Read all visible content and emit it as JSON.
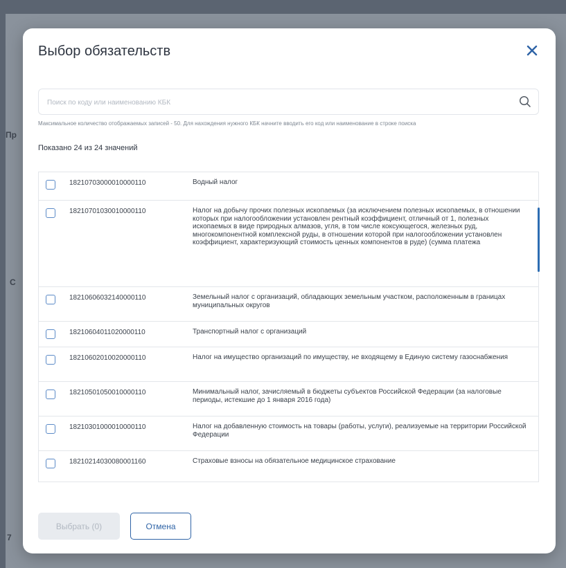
{
  "background": {
    "hints": [
      "Пр",
      "С",
      "7"
    ]
  },
  "modal": {
    "title": "Выбор обязательств",
    "close_icon": "close-icon",
    "search": {
      "placeholder": "Поиск по коду или наименованию КБК",
      "value": "",
      "icon": "search-icon"
    },
    "hint": "Максимальное количество отображаемых записей - 50. Для нахождения нужного КБК начните вводить его код или наименование в строке поиска",
    "shown_text": "Показано 24 из 24 значений",
    "rows": [
      {
        "code": "18210703000010000110",
        "name": "Водный налог"
      },
      {
        "code": "18210701030010000110",
        "name": "Налог на добычу прочих полезных ископаемых (за исключением полезных ископаемых, в отношении которых при налогообложении установлен рентный коэффициент, отличный от 1, полезных ископаемых в виде природных алмазов, угля, в том числе коксующегося, железных руд, многокомпонентной комплексной руды, в отношении которой при налогообложении установлен коэффициент, характеризующий стоимость ценных компонентов в руде) (сумма платежа"
      },
      {
        "code": "18210606032140000110",
        "name": "Земельный налог с организаций, обладающих земельным участком, расположенным в границах муниципальных округов"
      },
      {
        "code": "18210604011020000110",
        "name": "Транспортный налог с организаций"
      },
      {
        "code": "18210602010020000110",
        "name": "Налог на имущество организаций по имуществу, не входящему в Единую систему газоснабжения"
      },
      {
        "code": "18210501050010000110",
        "name": "Минимальный налог, зачисляемый в бюджеты субъектов Российской Федерации (за налоговые периоды, истекшие до 1 января 2016 года)"
      },
      {
        "code": "18210301000010000110",
        "name": "Налог на добавленную стоимость на товары (работы, услуги), реализуемые на территории Российской Федерации"
      },
      {
        "code": "18210214030080001160",
        "name": "Страховые взносы на обязательное медицинское страхование"
      }
    ],
    "footer": {
      "select_label": "Выбрать (0)",
      "cancel_label": "Отмена"
    }
  },
  "colors": {
    "accent": "#2e63a6",
    "checkbox_border": "#5b8ac7",
    "scrollbar": "#2d6db3"
  }
}
